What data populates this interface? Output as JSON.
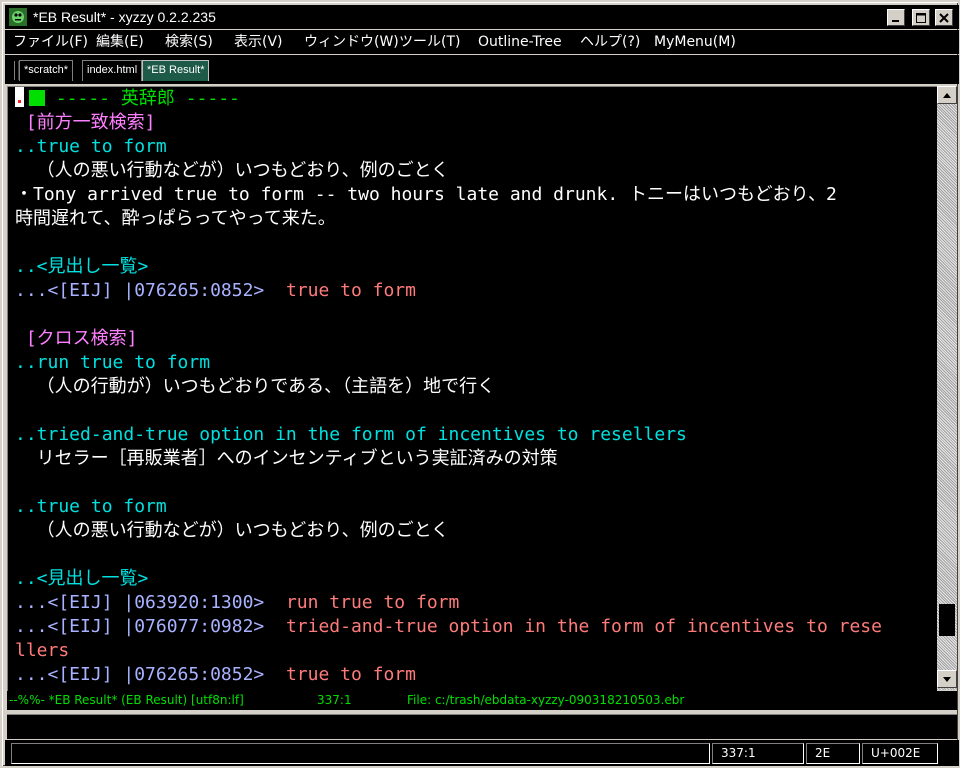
{
  "window": {
    "title": "*EB Result* - xyzzy 0.2.2.235",
    "icon": "xyzzy-app-icon",
    "controls": [
      "minimize-icon",
      "maximize-icon",
      "close-icon"
    ]
  },
  "menubar": {
    "items": [
      "ファイル(F)",
      "編集(E)",
      "検索(S)",
      "表示(V)",
      "ウィンドウ(W)",
      "ツール(T)",
      "Outline-Tree",
      "ヘルプ(?)",
      "MyMenu(M)"
    ]
  },
  "tabs": [
    "*scratch*",
    "index.html",
    "*EB Result*"
  ],
  "active_tab": "*EB Result*",
  "editor": {
    "lines": [
      {
        "color": "green",
        "text": "----- 英辞郎 -----",
        "cursor": true
      },
      {
        "color": "magenta",
        "text": " [前方一致検索]"
      },
      {
        "color": "cyan",
        "text": "..true to form"
      },
      {
        "color": "white",
        "text": "  （人の悪い行動などが）いつもどおり、例のごとく"
      },
      {
        "color": "white",
        "text": "・Tony arrived true to form -- two hours late and drunk. トニーはいつもどおり、2"
      },
      {
        "color": "white",
        "text": "時間遅れて、酔っぱらってやって来た。"
      },
      {
        "color": "white",
        "text": ""
      },
      {
        "color": "cyan",
        "text": "..<見出し一覧>"
      },
      {
        "color": "ref",
        "text": "...<[EIJ] |076265:0852>",
        "target": "true to form"
      },
      {
        "color": "white",
        "text": ""
      },
      {
        "color": "magenta",
        "text": " [クロス検索]"
      },
      {
        "color": "cyan",
        "text": "..run true to form"
      },
      {
        "color": "white",
        "text": "  （人の行動が）いつもどおりである、（主語を）地で行く"
      },
      {
        "color": "white",
        "text": ""
      },
      {
        "color": "cyan",
        "text": "..tried-and-true option in the form of incentives to resellers"
      },
      {
        "color": "white",
        "text": "  リセラー［再販業者］へのインセンティブという実証済みの対策"
      },
      {
        "color": "white",
        "text": ""
      },
      {
        "color": "cyan",
        "text": "..true to form"
      },
      {
        "color": "white",
        "text": "  （人の悪い行動などが）いつもどおり、例のごとく"
      },
      {
        "color": "white",
        "text": ""
      },
      {
        "color": "cyan",
        "text": "..<見出し一覧>"
      },
      {
        "color": "ref",
        "text": "...<[EIJ] |063920:1300>",
        "target": "run true to form"
      },
      {
        "color": "ref",
        "text": "...<[EIJ] |076077:0982>",
        "target": "tried-and-true option in the form of incentives to rese"
      },
      {
        "color": "salmon",
        "text": "llers"
      },
      {
        "color": "ref",
        "text": "...<[EIJ] |076265:0852>",
        "target": "true to form"
      }
    ]
  },
  "modeline": {
    "status": "--%%- *EB Result* (EB Result) [utf8n:lf]",
    "position": "337:1",
    "file": "File: c:/trash/ebdata-xyzzy-090318210503.ebr"
  },
  "minibuffer": "",
  "statusbar": {
    "position": "337:1",
    "char_hex": "2E",
    "codepoint": "U+002E"
  },
  "colors": {
    "background": "#000000",
    "heading": "#00e000",
    "section": "#ff80ff",
    "entry": "#00e0e0",
    "body": "#ffffff",
    "link": "#ff7b7b",
    "ref_prefix": "#a9b2ff"
  }
}
